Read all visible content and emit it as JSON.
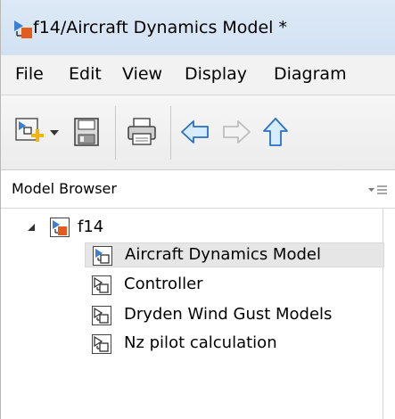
{
  "window": {
    "title": "f14/Aircraft Dynamics Model *"
  },
  "menubar": {
    "items": [
      {
        "label": "File"
      },
      {
        "label": "Edit"
      },
      {
        "label": "View"
      },
      {
        "label": "Display"
      },
      {
        "label": "Diagram"
      }
    ]
  },
  "toolbar": {
    "buttons": [
      {
        "icon": "new-model-icon"
      },
      {
        "icon": "dropdown-arrow-icon"
      },
      {
        "icon": "save-icon"
      },
      {
        "icon": "print-icon"
      },
      {
        "icon": "back-arrow-icon"
      },
      {
        "icon": "forward-arrow-icon"
      },
      {
        "icon": "up-arrow-icon"
      }
    ]
  },
  "model_browser": {
    "title": "Model Browser",
    "menu_icon": "panel-menu-icon",
    "root": {
      "label": "f14",
      "expanded": true
    },
    "children": [
      {
        "label": "Aircraft Dynamics Model",
        "selected": true
      },
      {
        "label": "Controller",
        "selected": false
      },
      {
        "label": "Dryden Wind Gust Models",
        "selected": false
      },
      {
        "label": "Nz pilot calculation",
        "selected": false
      }
    ]
  },
  "colors": {
    "title_bar": "#d8e6f4",
    "menu_bar": "#f2f2f2",
    "selection": "#e6e6e6",
    "accent_blue": "#4a90d9",
    "accent_orange": "#e35b1f"
  }
}
